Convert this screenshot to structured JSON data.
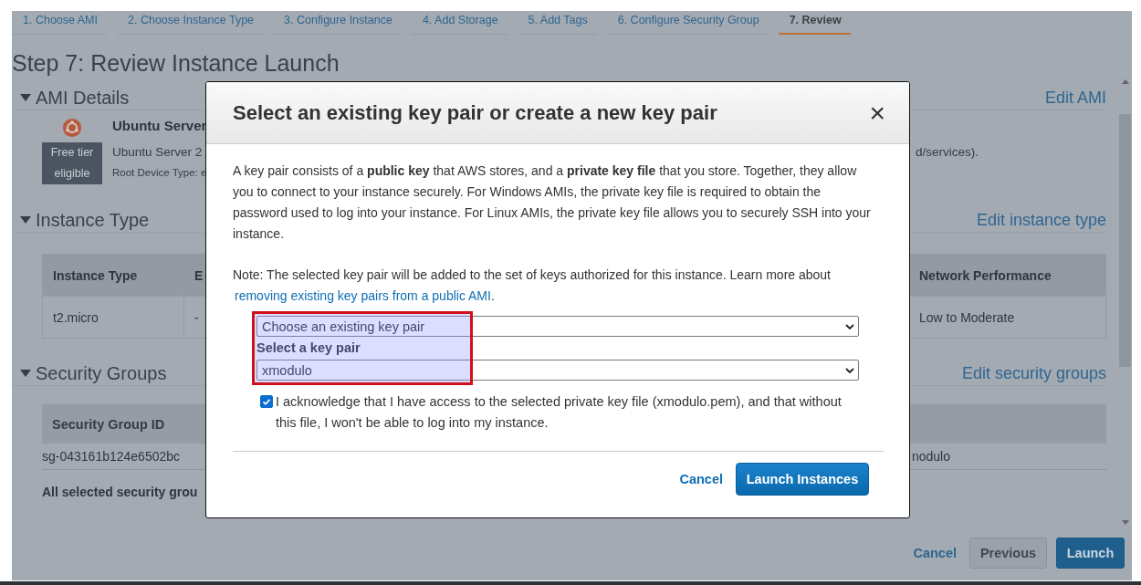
{
  "wizard_tabs": [
    {
      "label": "1. Choose AMI",
      "selected": false
    },
    {
      "label": "2. Choose Instance Type",
      "selected": false
    },
    {
      "label": "3. Configure Instance",
      "selected": false
    },
    {
      "label": "4. Add Storage",
      "selected": false
    },
    {
      "label": "5. Add Tags",
      "selected": false
    },
    {
      "label": "6. Configure Security Group",
      "selected": false
    },
    {
      "label": "7. Review",
      "selected": true
    }
  ],
  "page_title": "Step 7: Review Instance Launch",
  "ami_details": {
    "heading": "AMI Details",
    "edit_link": "Edit AMI",
    "ami_name": "Ubuntu Server",
    "badge": "Free tier eligible",
    "description": "Ubuntu Server 2",
    "description_end": "d/services).",
    "root_device": "Root Device Type: e"
  },
  "instance_type": {
    "heading": "Instance Type",
    "edit_link": "Edit instance type",
    "columns": [
      "Instance Type",
      "E",
      "Network Performance"
    ],
    "row": [
      "t2.micro",
      "-",
      "Low to Moderate"
    ]
  },
  "security_groups": {
    "heading": "Security Groups",
    "edit_link": "Edit security groups",
    "columns": [
      "Security Group ID"
    ],
    "row": [
      "sg-043161b124e6502bc",
      "nodulo"
    ],
    "note": "All selected security grou"
  },
  "footer": {
    "cancel": "Cancel",
    "previous": "Previous",
    "launch": "Launch"
  },
  "modal": {
    "title": "Select an existing key pair or create a new key pair",
    "close": "×",
    "intro": "A key pair consists of a **public key** that AWS stores, and a **private key file** that you store. Together, they allow you to connect to your instance securely. For Windows AMIs, the private key file is required to obtain the password used to log into your instance. For Linux AMIs, the private key file allows you to securely SSH into your instance.",
    "note": "Note: The selected key pair will be added to the set of keys authorized for this instance. Learn more about",
    "note_link": "removing existing key pairs from a public AMI",
    "note_end": ".",
    "action_select": "Choose an existing key pair",
    "key_label": "Select a key pair",
    "key_select": "xmodulo",
    "acknowledge": {
      "checked": true,
      "text": "I acknowledge that I have access to the selected private key file (xmodulo.pem), and that without this file, I won't be able to log into my instance."
    },
    "cancel": "Cancel",
    "launch": "Launch Instances"
  }
}
